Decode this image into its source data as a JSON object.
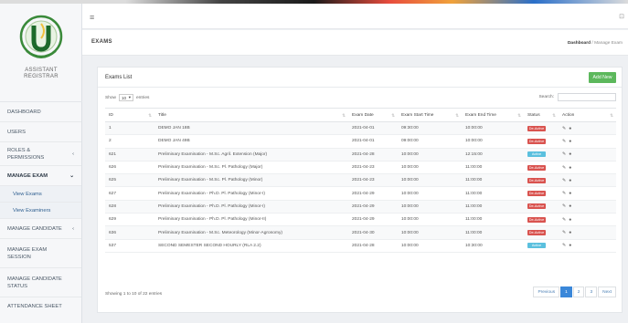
{
  "app": {
    "hamburger": "≡",
    "corner_icon": "⊡"
  },
  "logo": {
    "line1": "ASSISTANT",
    "line2": "REGISTRAR"
  },
  "sidebar": {
    "items": [
      {
        "label": "DASHBOARD",
        "chevron": ""
      },
      {
        "label": "USERS",
        "chevron": ""
      },
      {
        "label": "ROLES &",
        "label2": "PERMISSIONS",
        "chevron": "‹"
      },
      {
        "label": "MANAGE EXAM",
        "chevron": "⌄"
      },
      {
        "label": "MANAGE CANDIDATE",
        "chevron": "‹"
      },
      {
        "label": "MANAGE EXAM",
        "label2": "SESSION",
        "chevron": ""
      },
      {
        "label": "MANAGE CANDIDATE",
        "label2": "STATUS",
        "chevron": ""
      },
      {
        "label": "ATTENDANCE SHEET",
        "chevron": ""
      }
    ],
    "sub": [
      "View Exams",
      "View Examiners"
    ]
  },
  "page": {
    "title": "EXAMS",
    "breadcrumb_home": "Dashboard",
    "breadcrumb_sep": "/",
    "breadcrumb_current": "Manage Exam"
  },
  "card": {
    "title": "Exams List",
    "add_button": "Add New",
    "show_label": "Show",
    "show_value": "10",
    "entries_label": "entries",
    "search_label": "Search:",
    "columns": [
      "ID",
      "Title",
      "Exam Date",
      "Exam Start Time",
      "Exam End Time",
      "Status",
      "Action"
    ],
    "rows": [
      {
        "id": "1",
        "title": "DEMO JAN 18B",
        "date": "2021-04-01",
        "start": "09:30:00",
        "end": "10:00:00",
        "status": "De-Active"
      },
      {
        "id": "2",
        "title": "DEMO JAN 49B",
        "date": "2021-04-01",
        "start": "09:00:00",
        "end": "10:00:00",
        "status": "De-Active"
      },
      {
        "id": "621",
        "title": "Preliminary Examination - M.Sc. Agril. Extension (Major)",
        "date": "2021-04-28",
        "start": "10:00:00",
        "end": "12:15:00",
        "status": "Active"
      },
      {
        "id": "626",
        "title": "Preliminary Examination - M.Sc. Pl. Pathology (Major)",
        "date": "2021-04-23",
        "start": "10:00:00",
        "end": "11:00:00",
        "status": "De-Active"
      },
      {
        "id": "625",
        "title": "Preliminary Examination - M.Sc. Pl. Pathology (Minor)",
        "date": "2021-04-23",
        "start": "10:00:00",
        "end": "11:00:00",
        "status": "De-Active"
      },
      {
        "id": "627",
        "title": "Preliminary Examination - Ph.D. Pl. Pathology (Minor-I)",
        "date": "2021-04-29",
        "start": "10:00:00",
        "end": "11:00:00",
        "status": "De-Active"
      },
      {
        "id": "628",
        "title": "Preliminary Examination - Ph.D. Pl. Pathology (Minor-I)",
        "date": "2021-04-29",
        "start": "10:00:00",
        "end": "11:00:00",
        "status": "De-Active"
      },
      {
        "id": "629",
        "title": "Preliminary Examination - Ph.D. Pl. Pathology (Minor-II)",
        "date": "2021-04-29",
        "start": "10:00:00",
        "end": "11:00:00",
        "status": "De-Active"
      },
      {
        "id": "636",
        "title": "Preliminary Examination - M.Sc. Meteorology (Minor-Agronomy)",
        "date": "2021-04-30",
        "start": "10:00:00",
        "end": "11:00:00",
        "status": "De-Active"
      },
      {
        "id": "537",
        "title": "SECOND SEMESTER SECOND HOURLY (RLA 2.2)",
        "date": "2021-04-28",
        "start": "10:00:00",
        "end": "10:30:00",
        "status": "Active"
      }
    ],
    "footer_info": "Showing 1 to 10 of 22 entries",
    "pager": [
      "Previous",
      "1",
      "2",
      "3",
      "Next"
    ],
    "pager_active": "1"
  },
  "colors": {
    "green_button": "#5cb85c",
    "status_red": "#d9534f",
    "status_blue": "#5bc0de",
    "pager_active": "#3a87d9"
  }
}
